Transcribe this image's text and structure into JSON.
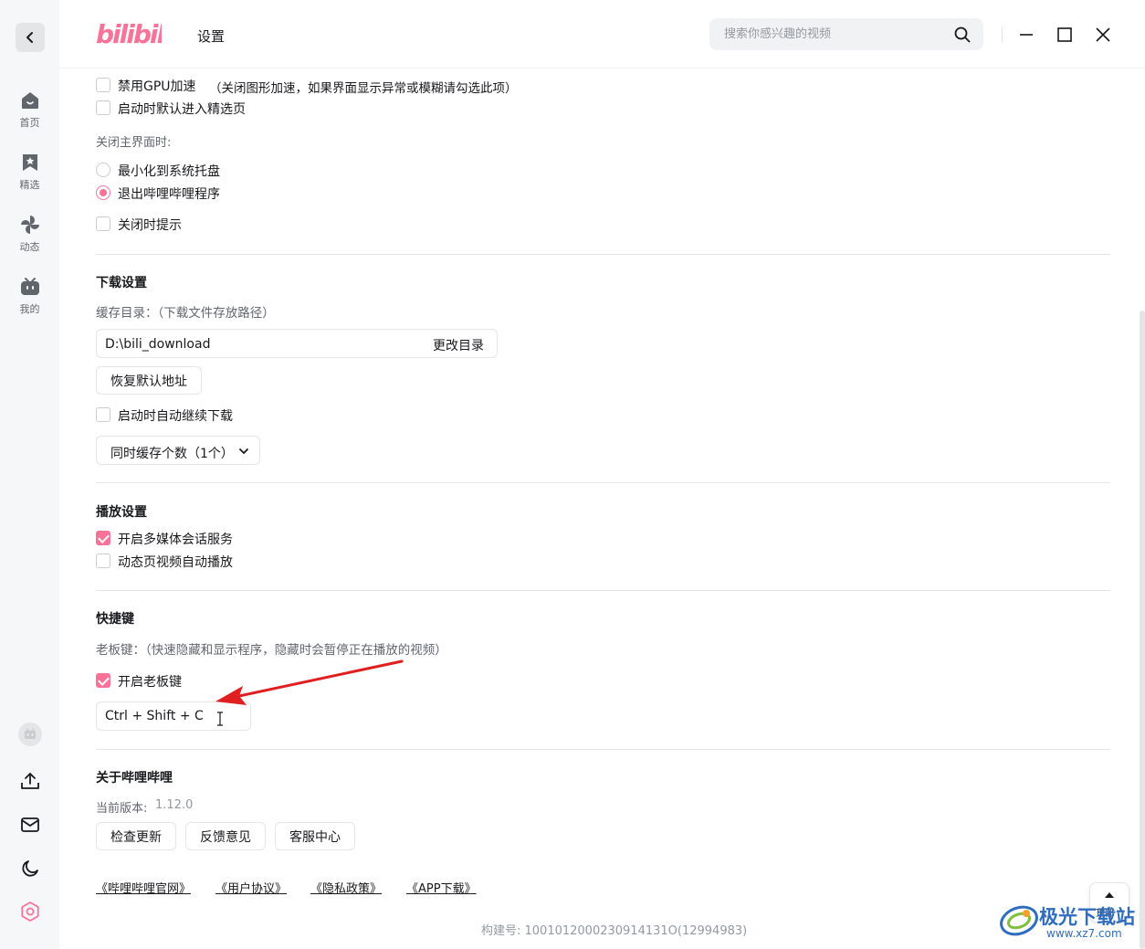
{
  "app": {
    "logo_text": "bilibili",
    "title": "设置",
    "brand_color": "#fb7299",
    "back_icon": "chevron-left-icon"
  },
  "search": {
    "placeholder": "搜索你感兴趣的视频",
    "icon": "search-icon"
  },
  "window_controls": [
    "minimize-icon",
    "maximize-icon",
    "close-icon"
  ],
  "sidebar": {
    "items": [
      {
        "label": "首页",
        "icon": "home-icon"
      },
      {
        "label": "精选",
        "icon": "bookmark-icon"
      },
      {
        "label": "动态",
        "icon": "pinwheel-icon"
      },
      {
        "label": "我的",
        "icon": "tv-icon"
      }
    ],
    "bottom_icons": [
      "avatar-icon",
      "upload-icon",
      "mail-icon",
      "moon-icon",
      "settings-icon"
    ]
  },
  "general": {
    "gpu_label": "禁用GPU加速",
    "gpu_hint": "（关闭图形加速，如果界面显示异常或模糊请勾选此项）",
    "gpu_checked": false,
    "featured_label": "启动时默认进入精选页",
    "featured_checked": false,
    "close_title": "关闭主界面时:",
    "minimize_label": "最小化到系统托盘",
    "exit_label": "退出哔哩哔哩程序",
    "close_selected": "exit",
    "close_tip_label": "关闭时提示",
    "close_tip_checked": false
  },
  "download": {
    "title": "下载设置",
    "cache_dir_label": "缓存目录：（下载文件存放路径）",
    "path": "D:\\bili_download",
    "change_label": "更改目录",
    "restore_label": "恢复默认地址",
    "auto_resume_label": "启动时自动继续下载",
    "auto_resume_checked": false,
    "concurrent_label": "同时缓存个数（1个）"
  },
  "playback": {
    "title": "播放设置",
    "media_session_label": "开启多媒体会话服务",
    "media_session_checked": true,
    "autoplay_label": "动态页视频自动播放",
    "autoplay_checked": false
  },
  "shortcuts": {
    "title": "快捷键",
    "boss_key_desc": "老板键：（快速隐藏和显示程序，隐藏时会暂停正在播放的视频）",
    "boss_key_toggle_label": "开启老板键",
    "boss_key_checked": true,
    "boss_key_value": "Ctrl + Shift + C"
  },
  "about": {
    "title": "关于哔哩哔哩",
    "version_label": "当前版本:",
    "version": "1.12.0",
    "buttons": [
      "检查更新",
      "反馈意见",
      "客服中心"
    ],
    "links": [
      "《哔哩哔哩官网》",
      "《用户协议》",
      "《隐私政策》",
      "《APP下载》"
    ],
    "build_label": "构建号: 1001012000230914131O(12994983)"
  },
  "top_button_label": "顶部",
  "watermark": {
    "title": "极光下载站",
    "url": "www.xz7.com"
  },
  "annotation_color": "#e02020"
}
